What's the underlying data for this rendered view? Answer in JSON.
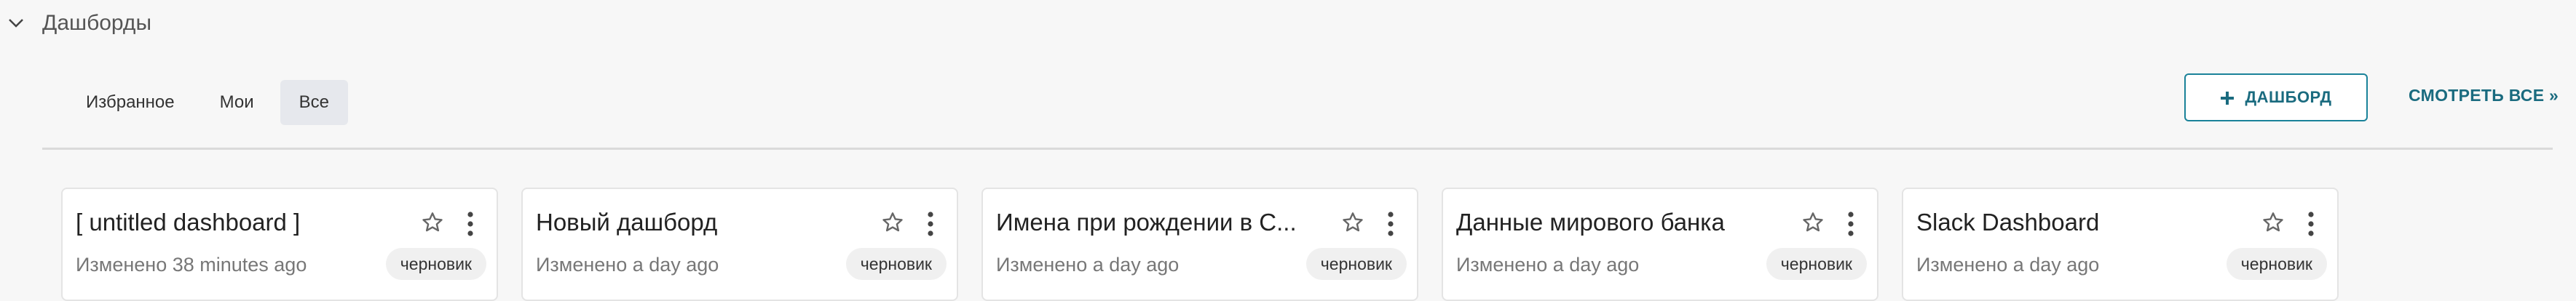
{
  "section": {
    "title": "Дашборды"
  },
  "filters": {
    "favorites": "Избранное",
    "mine": "Мои",
    "all": "Все"
  },
  "actions": {
    "add_label": "ДАШБОРД",
    "view_all_label": "СМОТРЕТЬ ВСЕ »"
  },
  "cards": [
    {
      "title": "[ untitled dashboard ]",
      "meta": "Изменено 38 minutes ago",
      "badge": "черновик"
    },
    {
      "title": "Новый дашборд",
      "meta": "Изменено a day ago",
      "badge": "черновик"
    },
    {
      "title": "Имена при рождении в С...",
      "meta": "Изменено a day ago",
      "badge": "черновик"
    },
    {
      "title": "Данные мирового банка",
      "meta": "Изменено a day ago",
      "badge": "черновик"
    },
    {
      "title": "Slack Dashboard",
      "meta": "Изменено a day ago",
      "badge": "черновик"
    }
  ],
  "colors": {
    "accent": "#1a6b7f",
    "active_tab_bg": "#e6e8ed"
  }
}
